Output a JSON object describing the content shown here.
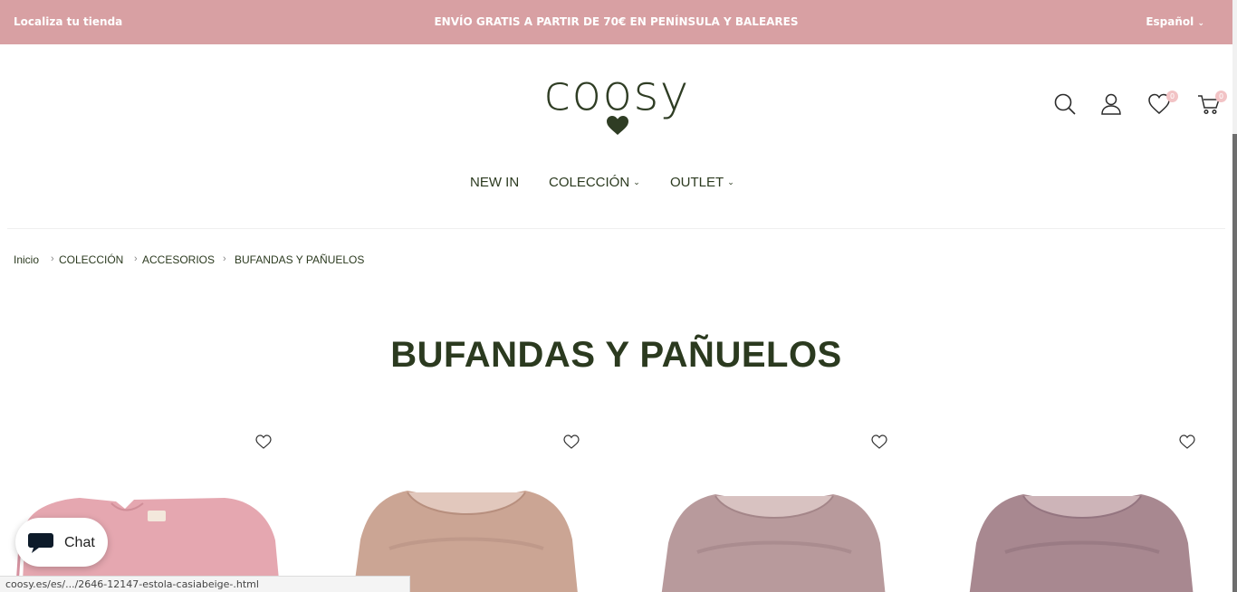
{
  "topbar": {
    "store_locator": "Localiza tu tienda",
    "promo": "ENVÍO GRATIS A PARTIR DE 70€ EN PENÍNSULA Y BALEARES",
    "language": "Español",
    "background_color": "#d8a0a3"
  },
  "brand": {
    "logo_text": "coosy",
    "logo_color": "#2f3d24"
  },
  "header_icons": {
    "search": "search-icon",
    "account": "user-icon",
    "wishlist": "heart-icon",
    "wishlist_count": "0",
    "cart": "cart-icon",
    "cart_count": "0"
  },
  "nav": {
    "items": [
      {
        "label": "NEW IN"
      },
      {
        "label": "COLECCIÓN"
      },
      {
        "label": "OUTLET"
      }
    ]
  },
  "breadcrumb": {
    "items": [
      "Inicio",
      "COLECCIÓN",
      "ACCESORIOS",
      "BUFANDAS Y PAÑUELOS"
    ]
  },
  "page": {
    "title": "BUFANDAS Y PAÑUELOS"
  },
  "products": [
    {
      "color": "#e5a7b0",
      "wishlist_icon": "heart-icon"
    },
    {
      "color": "#cba594",
      "wishlist_icon": "heart-icon"
    },
    {
      "color": "#b89a9c",
      "wishlist_icon": "heart-icon"
    },
    {
      "color": "#a88890",
      "wishlist_icon": "heart-icon"
    }
  ],
  "chat": {
    "label": "Chat",
    "icon": "chat-bubble-icon"
  },
  "status_bar": {
    "url": "coosy.es/es/.../2646-12147-estola-casiabeige-.html"
  }
}
